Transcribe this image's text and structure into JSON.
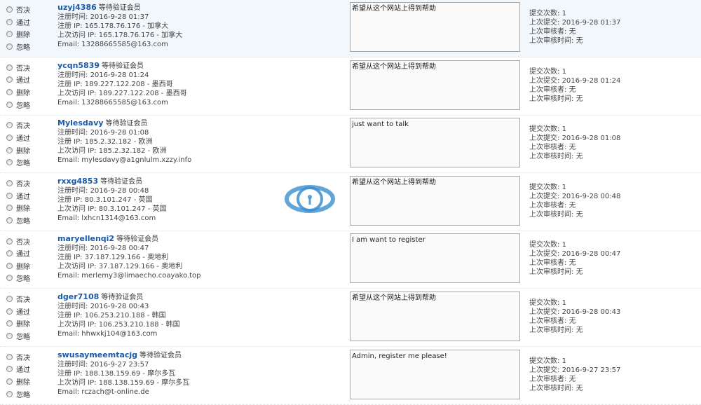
{
  "options": [
    "否决",
    "通过",
    "删除",
    "忽略"
  ],
  "labels": {
    "status": "等待验证会员",
    "reg_time": "注册时间: ",
    "reg_ip": "注册 IP: ",
    "last_ip": "上次访问 IP: ",
    "email": "Email: ",
    "submit_count": "提交次数: ",
    "last_submit": "上次提交: ",
    "last_reviewer": "上次审核者: ",
    "last_review_time": "上次审核时间: "
  },
  "members": [
    {
      "username": "uzyj4386",
      "reg_time": "2016-9-28 01:37",
      "reg_ip": "165.178.76.176 - 加拿大",
      "last_ip": "165.178.76.176 - 加拿大",
      "email": "13288665585@163.com",
      "message": "希望从这个网站上得到帮助",
      "submit_count": "1",
      "last_submit": "2016-9-28 01:37",
      "last_reviewer": "无",
      "last_review_time": "无"
    },
    {
      "username": "ycqn5839",
      "reg_time": "2016-9-28 01:24",
      "reg_ip": "189.227.122.208 - 墨西哥",
      "last_ip": "189.227.122.208 - 墨西哥",
      "email": "13288665585@163.com",
      "message": "希望从这个网站上得到帮助",
      "submit_count": "1",
      "last_submit": "2016-9-28 01:24",
      "last_reviewer": "无",
      "last_review_time": "无"
    },
    {
      "username": "Mylesdavy",
      "reg_time": "2016-9-28 01:08",
      "reg_ip": "185.2.32.182 - 欧洲",
      "last_ip": "185.2.32.182 - 欧洲",
      "email": "mylesdavy@a1gnlulm.xzzy.info",
      "message": "just want to talk",
      "submit_count": "1",
      "last_submit": "2016-9-28 01:08",
      "last_reviewer": "无",
      "last_review_time": "无"
    },
    {
      "username": "rxxg4853",
      "reg_time": "2016-9-28 00:48",
      "reg_ip": "80.3.101.247 - 英国",
      "last_ip": "80.3.101.247 - 英国",
      "email": "lxhcn1314@163.com",
      "message": "希望从这个网站上得到帮助",
      "submit_count": "1",
      "last_submit": "2016-9-28 00:48",
      "last_reviewer": "无",
      "last_review_time": "无"
    },
    {
      "username": "maryellenqi2",
      "reg_time": "2016-9-28 00:47",
      "reg_ip": "37.187.129.166 - 奥地利",
      "last_ip": "37.187.129.166 - 奥地利",
      "email": "merlemy3@limaecho.coayako.top",
      "message": "I am want to register",
      "submit_count": "1",
      "last_submit": "2016-9-28 00:47",
      "last_reviewer": "无",
      "last_review_time": "无"
    },
    {
      "username": "dger7108",
      "reg_time": "2016-9-28 00:43",
      "reg_ip": "106.253.210.188 - 韩国",
      "last_ip": "106.253.210.188 - 韩国",
      "email": "hhwxkj104@163.com",
      "message": "希望从这个网站上得到帮助",
      "submit_count": "1",
      "last_submit": "2016-9-28 00:43",
      "last_reviewer": "无",
      "last_review_time": "无"
    },
    {
      "username": "swusaymeemtacjg",
      "reg_time": "2016-9-27 23:57",
      "reg_ip": "188.138.159.69 - 摩尔多瓦",
      "last_ip": "188.138.159.69 - 摩尔多瓦",
      "email": "rczach@t-online.de",
      "message": "Admin, register me please!",
      "submit_count": "1",
      "last_submit": "2016-9-27 23:57",
      "last_reviewer": "无",
      "last_review_time": "无"
    }
  ],
  "colors": {
    "username": "#1a5aa8",
    "row_highlight": "#f2f7fc",
    "watermark": "#3b8fd0"
  },
  "watermark_icon": "logo-watermark-icon"
}
